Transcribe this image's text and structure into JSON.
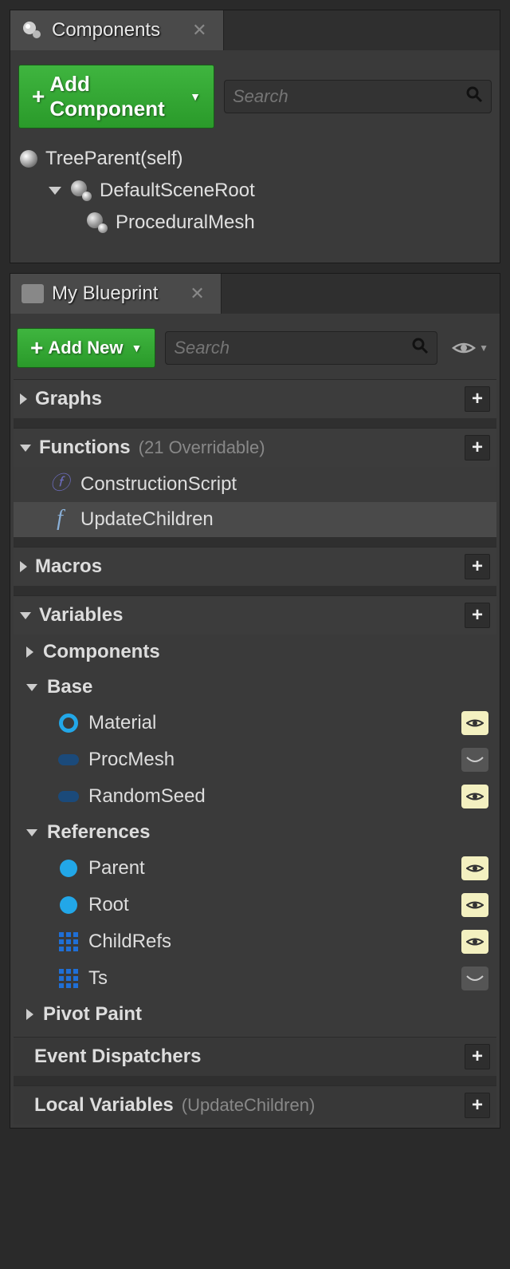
{
  "components": {
    "tab_title": "Components",
    "add_button": "Add Component",
    "search_placeholder": "Search",
    "tree": {
      "root": "TreeParent(self)",
      "scene_root": "DefaultSceneRoot",
      "child": "ProceduralMesh"
    }
  },
  "blueprint": {
    "tab_title": "My Blueprint",
    "add_button": "Add New",
    "search_placeholder": "Search",
    "sections": {
      "graphs": {
        "title": "Graphs"
      },
      "functions": {
        "title": "Functions",
        "note": "(21 Overridable)",
        "items": [
          "ConstructionScript",
          "UpdateChildren"
        ]
      },
      "macros": {
        "title": "Macros"
      },
      "variables": {
        "title": "Variables",
        "components": {
          "title": "Components"
        },
        "base": {
          "title": "Base",
          "items": [
            {
              "name": "Material",
              "icon": "circle-hollow",
              "visible": true
            },
            {
              "name": "ProcMesh",
              "icon": "pill",
              "visible": false
            },
            {
              "name": "RandomSeed",
              "icon": "pill",
              "visible": true
            }
          ]
        },
        "references": {
          "title": "References",
          "items": [
            {
              "name": "Parent",
              "icon": "circle-solid",
              "visible": true
            },
            {
              "name": "Root",
              "icon": "circle-solid",
              "visible": true
            },
            {
              "name": "ChildRefs",
              "icon": "grid",
              "visible": true
            },
            {
              "name": "Ts",
              "icon": "grid",
              "visible": false
            }
          ]
        },
        "pivot_paint": {
          "title": "Pivot Paint"
        }
      },
      "event_dispatchers": {
        "title": "Event Dispatchers"
      },
      "local_variables": {
        "title": "Local Variables",
        "note": "(UpdateChildren)"
      }
    }
  }
}
